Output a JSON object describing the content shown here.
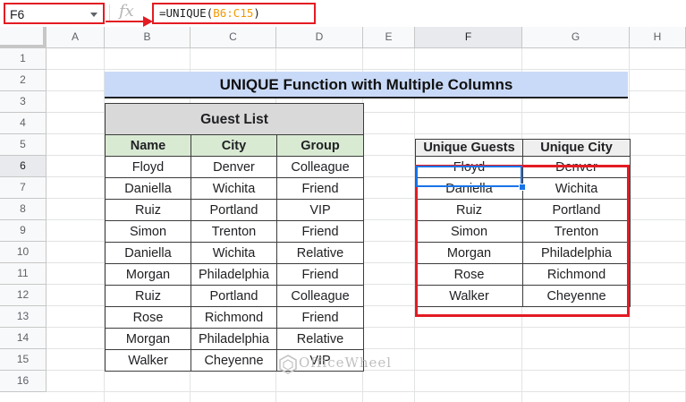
{
  "name_box": "F6",
  "formula": {
    "prefix": "=UNIQUE(",
    "ref": "B6:C15",
    "suffix": ")"
  },
  "fx_label": "fx",
  "columns": [
    "A",
    "B",
    "C",
    "D",
    "E",
    "F",
    "G",
    "H"
  ],
  "active_column": "F",
  "rows": [
    "1",
    "2",
    "3",
    "4",
    "5",
    "6",
    "7",
    "8",
    "9",
    "10",
    "11",
    "12",
    "13",
    "14",
    "15",
    "16"
  ],
  "active_row": "6",
  "title": "UNIQUE Function with Multiple Columns",
  "guest_list": {
    "title": "Guest List",
    "headers": [
      "Name",
      "City",
      "Group"
    ],
    "rows": [
      [
        "Floyd",
        "Denver",
        "Colleague"
      ],
      [
        "Daniella",
        "Wichita",
        "Friend"
      ],
      [
        "Ruiz",
        "Portland",
        "VIP"
      ],
      [
        "Simon",
        "Trenton",
        "Friend"
      ],
      [
        "Daniella",
        "Wichita",
        "Relative"
      ],
      [
        "Morgan",
        "Philadelphia",
        "Friend"
      ],
      [
        "Ruiz",
        "Portland",
        "Colleague"
      ],
      [
        "Rose",
        "Richmond",
        "Friend"
      ],
      [
        "Morgan",
        "Philadelphia",
        "Relative"
      ],
      [
        "Walker",
        "Cheyenne",
        "VIP"
      ]
    ]
  },
  "unique": {
    "headers": [
      "Unique Guests",
      "Unique City"
    ],
    "rows": [
      [
        "Floyd",
        "Denver"
      ],
      [
        "Daniella",
        "Wichita"
      ],
      [
        "Ruiz",
        "Portland"
      ],
      [
        "Simon",
        "Trenton"
      ],
      [
        "Morgan",
        "Philadelphia"
      ],
      [
        "Rose",
        "Richmond"
      ],
      [
        "Walker",
        "Cheyenne"
      ]
    ]
  },
  "watermark": "OfficeWheel",
  "colors": {
    "highlight_red": "#e31b23",
    "selection_blue": "#1a73e8",
    "title_bg": "#c9daf8",
    "header_green": "#d9ead3"
  }
}
